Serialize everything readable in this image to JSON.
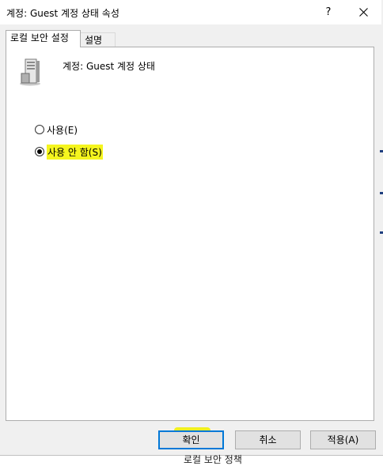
{
  "window": {
    "title": "계정: Guest 계정 상태 속성",
    "help_label": "?"
  },
  "tabs": [
    {
      "label": "로컬 보안 설정",
      "active": true
    },
    {
      "label": "설명",
      "active": false
    }
  ],
  "panel": {
    "header_label": "계정: Guest 계정 상태",
    "icon": "server-icon",
    "options": [
      {
        "label": "사용(E)",
        "selected": false
      },
      {
        "label": "사용 안 함(S)",
        "selected": true
      }
    ]
  },
  "buttons": {
    "ok": "확인",
    "cancel": "취소",
    "apply": "적용(A)"
  },
  "background": {
    "partial_text": "로컬 보안 정책"
  },
  "colors": {
    "highlight": "#f5f51e",
    "focus_border": "#0078d7"
  }
}
